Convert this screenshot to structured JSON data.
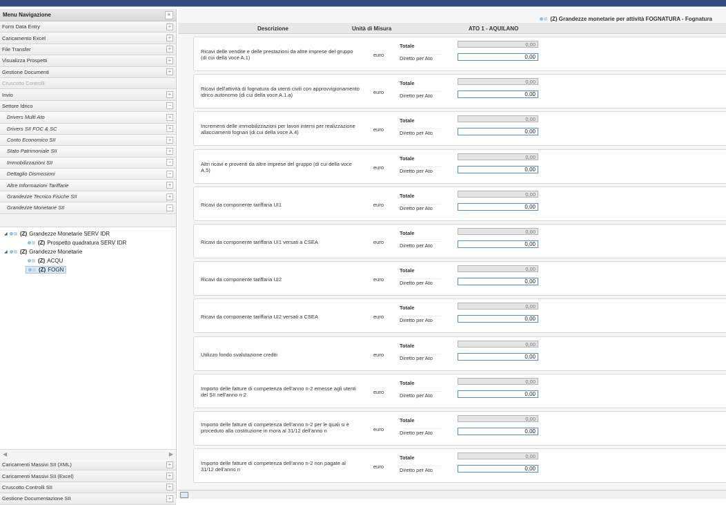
{
  "sidebar": {
    "header": "Menu Navigazione",
    "collapse_glyph": "«",
    "items": [
      {
        "label": "Form Data Entry",
        "state": "+"
      },
      {
        "label": "Caricamento Excel",
        "state": "+"
      },
      {
        "label": "File Transfer",
        "state": "+"
      },
      {
        "label": "Visualizza Prospetti",
        "state": "+"
      },
      {
        "label": "Gestione Documenti",
        "state": "+"
      },
      {
        "label": "Cruscotto Controlli",
        "state": ""
      },
      {
        "label": "Invio",
        "state": "+"
      },
      {
        "label": "Settore Idrico",
        "state": "−"
      }
    ],
    "sub_items": [
      {
        "label": "Drivers Multi Ato",
        "state": "+"
      },
      {
        "label": "Drivers SII FOC & SC",
        "state": "+"
      },
      {
        "label": "Conto Economico SII",
        "state": "+"
      },
      {
        "label": "Stato Patrimoniale SII",
        "state": "+"
      },
      {
        "label": "Immobilizzazioni SII",
        "state": "−"
      },
      {
        "label": "Dettaglio Dismissioni",
        "state": "−"
      },
      {
        "label": "Altre Informazioni Tariffarie",
        "state": "+"
      },
      {
        "label": "Grandezze Tecnico Fisiche SII",
        "state": "+"
      },
      {
        "label": "Grandezze Monetarie SII",
        "state": "−"
      }
    ],
    "tree": {
      "n1_prefix": "(Z)",
      "n1_label": "Grandezze Monetarie SERV IDR",
      "n2_prefix": "(Z)",
      "n2_label": "Prospetto quadratura SERV IDR",
      "n3_prefix": "(Z)",
      "n3_label": "Grandezze Monetarie",
      "n4_prefix": "(Z)",
      "n4_label": "ACQU",
      "n5_prefix": "(Z)",
      "n5_label": "FOGN"
    },
    "bottom_items": [
      {
        "label": "Caricamenti Massivi SII (XML)",
        "state": "+"
      },
      {
        "label": "Caricamenti Massivi SII (Excel)",
        "state": "+"
      },
      {
        "label": "Cruscotto Controlli SII",
        "state": "+"
      },
      {
        "label": "Gestione Documentazione SII",
        "state": "+"
      }
    ]
  },
  "main": {
    "title": "(Z) Grandezze monetarie per attività FOGNATURA - Fognatura",
    "col_desc": "Descrizione",
    "col_unit": "Unità di Misura",
    "col_ato": "ATO 1 - AQUILANO",
    "label_totale": "Totale",
    "label_diretto": "Diretto per Ato",
    "rows": [
      {
        "desc": "Ricavi delle vendite e delle prestazioni da altre imprese del gruppo (di cui della voce A.1)",
        "unit": "euro",
        "totale": "0,00",
        "diretto": "0,00"
      },
      {
        "desc": "Ricavi dell'attività di fognatura da utenti civili con approvvigionamento idrico autonomo (di cui della voce A.1.a)",
        "unit": "euro",
        "totale": "0,00",
        "diretto": "0,00"
      },
      {
        "desc": "Incrementi delle immobilizzazioni per lavori interni per realizzazione allacciamenti fognari (di cui della voce A.4)",
        "unit": "euro",
        "totale": "0,00",
        "diretto": "0,00"
      },
      {
        "desc": "Altri ricavi e proventi da altre imprese del gruppo (di cui della voce A.5)",
        "unit": "euro",
        "totale": "0,00",
        "diretto": "0,00"
      },
      {
        "desc": "Ricavi da componente tariffaria UI1",
        "unit": "euro",
        "totale": "0,00",
        "diretto": "0,00"
      },
      {
        "desc": "Ricavi da componente tariffaria UI1 versati a CSEA",
        "unit": "euro",
        "totale": "0,00",
        "diretto": "0,00"
      },
      {
        "desc": "Ricavi da componente tariffaria UI2",
        "unit": "euro",
        "totale": "0,00",
        "diretto": "0,00"
      },
      {
        "desc": "Ricavi da componente tariffaria UI2 versati a CSEA",
        "unit": "euro",
        "totale": "0,00",
        "diretto": "0,00"
      },
      {
        "desc": "Utilizzo fondo svalutazione crediti",
        "unit": "euro",
        "totale": "0,00",
        "diretto": "0,00"
      },
      {
        "desc": "Importo delle fatture di competenza dell'anno n-2 emesse agli utenti del SII nell'anno n-2",
        "unit": "euro",
        "totale": "0,00",
        "diretto": "0,00"
      },
      {
        "desc": "Importo delle fatture di competenza dell'anno n-2 per le quali si è proceduto alla costituzione in mora al 31/12 dell'anno n",
        "unit": "euro",
        "totale": "0,00",
        "diretto": "0,00"
      },
      {
        "desc": "Importo delle fatture di competenza dell'anno n-2 non pagate al 31/12 dell'anno n",
        "unit": "euro",
        "totale": "0,00",
        "diretto": "0,00"
      }
    ]
  }
}
